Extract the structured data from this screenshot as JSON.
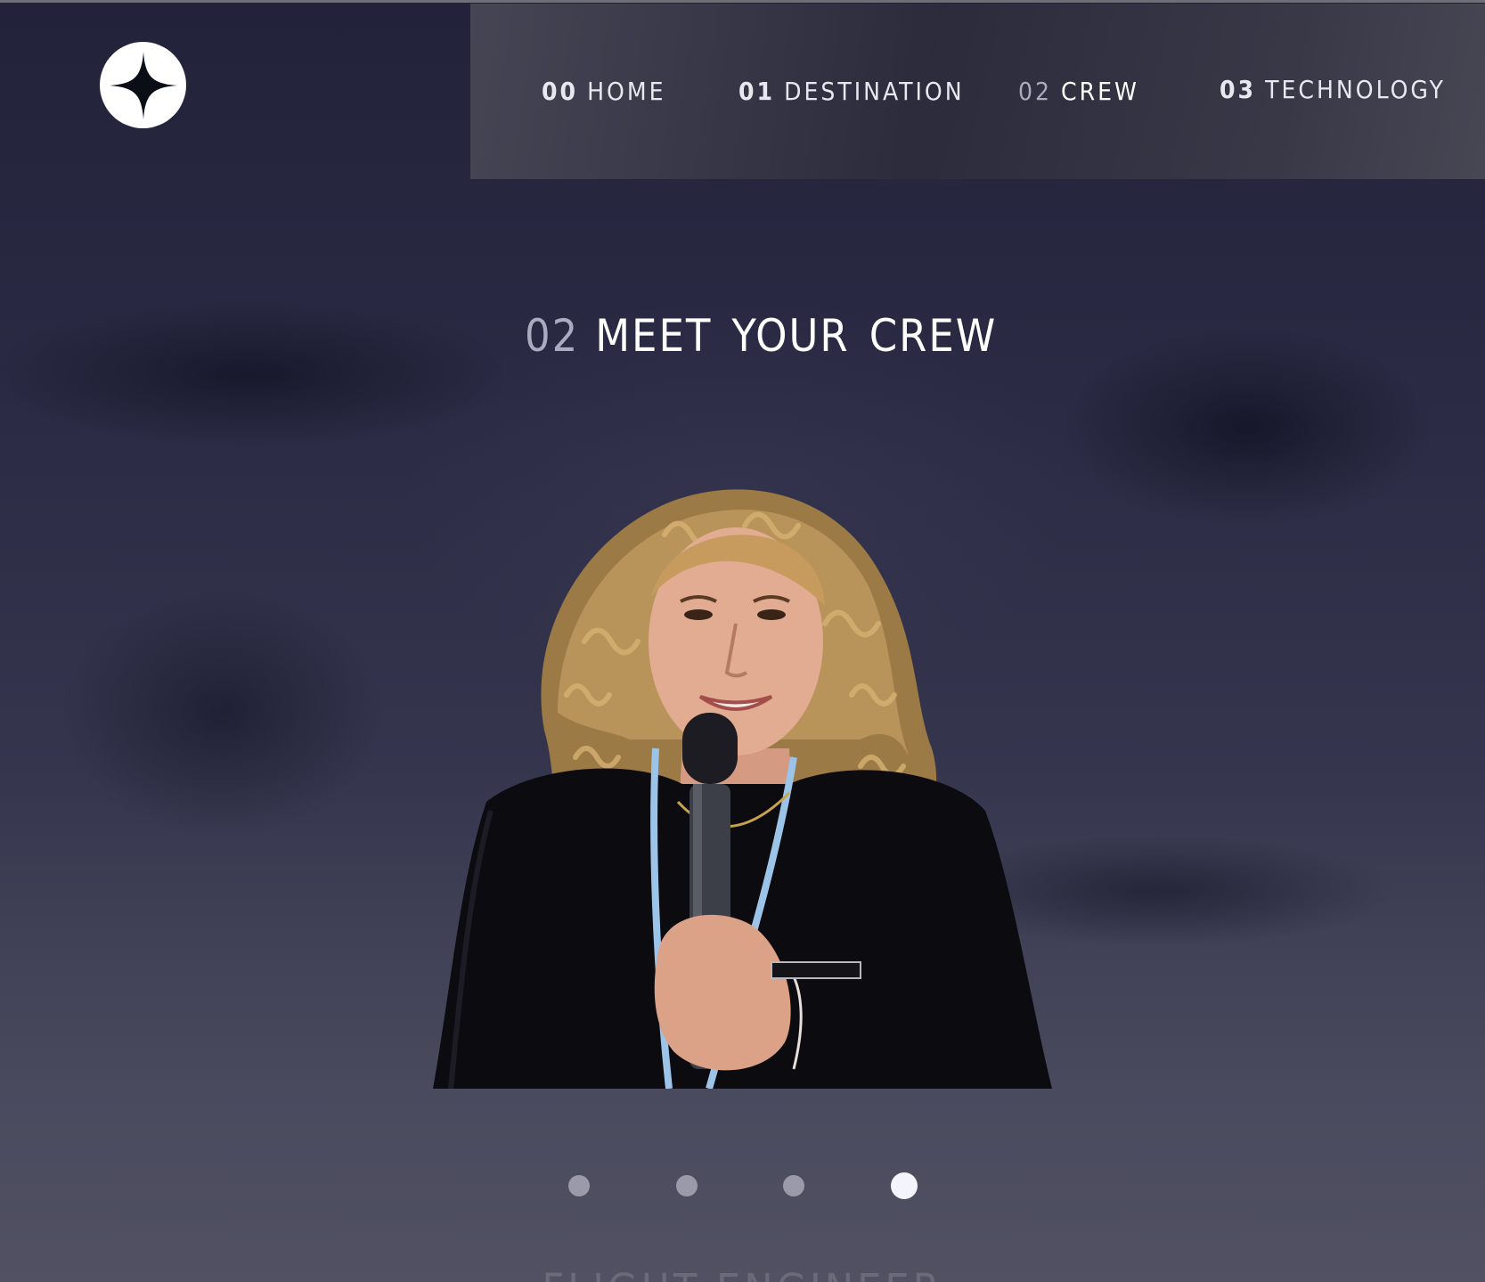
{
  "brand": {
    "logo_icon": "star-icon"
  },
  "nav": {
    "items": [
      {
        "num": "00",
        "label": "HOME"
      },
      {
        "num": "01",
        "label": "DESTINATION"
      },
      {
        "num": "02",
        "label": "CREW",
        "active": true
      },
      {
        "num": "03",
        "label": "TECHNOLOGY"
      }
    ]
  },
  "heading": {
    "num": "02",
    "words": [
      "MEET",
      "YOUR",
      "CREW"
    ]
  },
  "crew": {
    "photo_icon": "crew-member-photo",
    "role": "FLIGHT ENGINEER"
  },
  "carousel": {
    "count": 4,
    "active_index": 3
  },
  "colors": {
    "accent": "#ffffff",
    "muted_number": "#a9abc0",
    "dot_inactive": "#9a9aa8",
    "dot_active": "#f4f4fc"
  }
}
